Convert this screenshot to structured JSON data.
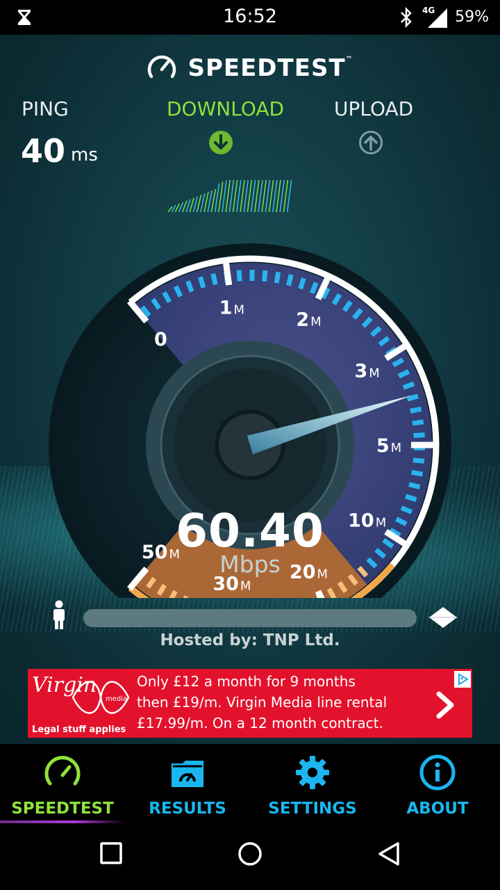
{
  "status": {
    "time": "16:52",
    "battery": "59%",
    "network": "4G"
  },
  "app": {
    "title": "SPEEDTEST",
    "trademark": "™"
  },
  "stats": {
    "ping_label": "PING",
    "ping_value": "40",
    "ping_unit": "ms",
    "download_label": "DOWNLOAD",
    "upload_label": "UPLOAD"
  },
  "gauge": {
    "ticks": [
      {
        "num": "0",
        "unit": ""
      },
      {
        "num": "1",
        "unit": "M"
      },
      {
        "num": "2",
        "unit": "M"
      },
      {
        "num": "3",
        "unit": "M"
      },
      {
        "num": "5",
        "unit": "M"
      },
      {
        "num": "10",
        "unit": "M"
      },
      {
        "num": "20",
        "unit": "M"
      },
      {
        "num": "30",
        "unit": "M"
      },
      {
        "num": "50",
        "unit": "M"
      }
    ],
    "speed_value": "60.40",
    "speed_unit": "Mbps"
  },
  "server": {
    "hosted_by": "Hosted by: TNP Ltd."
  },
  "ad": {
    "brand": "Virgin",
    "brand_sub": "media",
    "disclaimer": "Legal stuff applies",
    "line1": "Only £12 a month for 9 months",
    "line2": "then £19/m. Virgin Media line rental",
    "line3": "£17.99/m. On a 12 month contract."
  },
  "tabs": [
    {
      "label": "SPEEDTEST"
    },
    {
      "label": "RESULTS"
    },
    {
      "label": "SETTINGS"
    },
    {
      "label": "ABOUT"
    }
  ],
  "colors": {
    "accent_green": "#8fe23a",
    "accent_blue": "#1ab6f0",
    "ad_red": "#e3122c"
  }
}
